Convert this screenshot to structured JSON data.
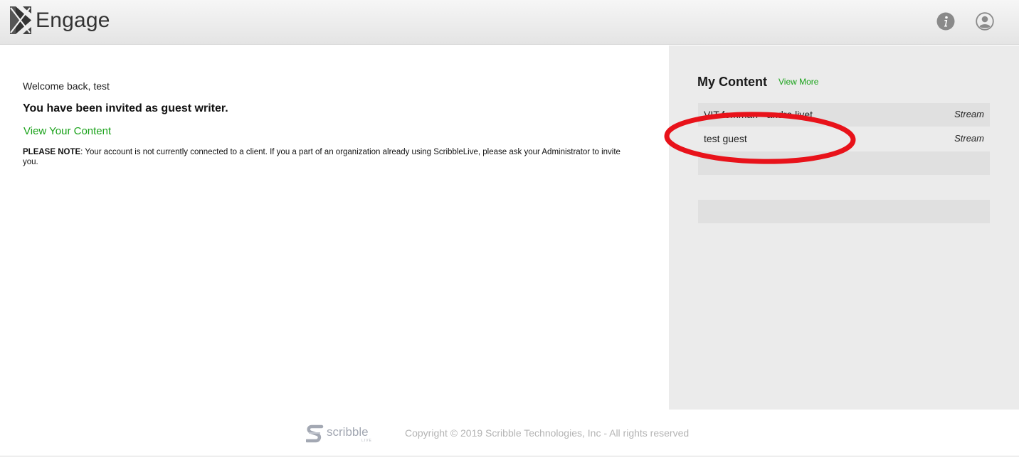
{
  "header": {
    "brand": "Engage",
    "icons": {
      "info": "info-icon",
      "user": "user-profile-icon"
    }
  },
  "main": {
    "welcome": "Welcome back, test",
    "invited": "You have been invited as guest writer.",
    "view_content": "View Your Content",
    "note_label": "PLEASE NOTE",
    "note_text": ": Your account is not currently connected to a client. If you a part of an organization already using ScribbleLive, please ask your Administrator to invite you."
  },
  "sidebar": {
    "title": "My Content",
    "view_more": "View More",
    "items": [
      {
        "title": "VIT femman - andra livet",
        "type": "Stream"
      },
      {
        "title": "test guest",
        "type": "Stream"
      },
      {
        "title": "",
        "type": ""
      },
      {
        "title": "",
        "type": ""
      },
      {
        "title": "",
        "type": ""
      }
    ]
  },
  "footer": {
    "brand": "scribble",
    "brand_sub": "LIVE",
    "copyright": "Copyright © 2019 Scribble Technologies, Inc - All rights reserved"
  },
  "colors": {
    "accent_green": "#1aa21a",
    "annotation_red": "#e8121a",
    "sidebar_bg": "#ebebeb"
  }
}
